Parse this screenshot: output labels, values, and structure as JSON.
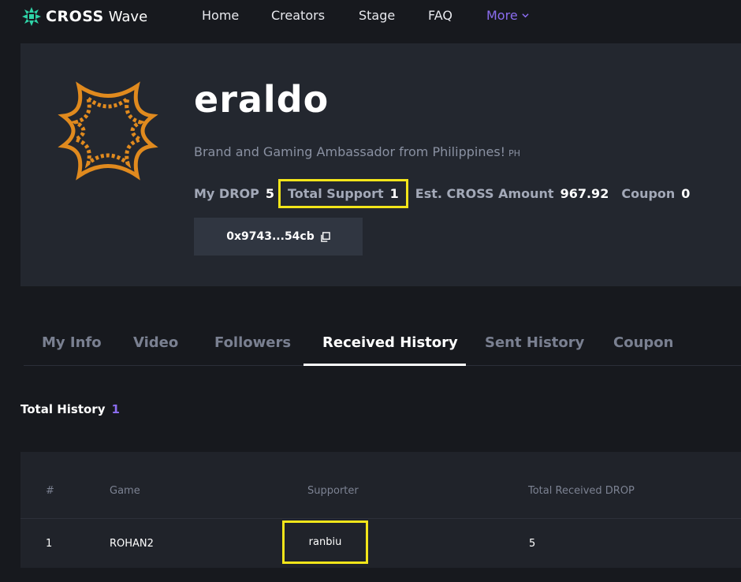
{
  "brand": {
    "name": "CROSS",
    "sub": "Wave",
    "accent": "#2fd3a7"
  },
  "nav": {
    "home": "Home",
    "creators": "Creators",
    "stage": "Stage",
    "faq": "FAQ",
    "more": "More"
  },
  "profile": {
    "name": "eraldo",
    "bio": "Brand and Gaming Ambassador from Philippines!",
    "country": "PH",
    "stats": {
      "my_drop_label": "My DROP",
      "my_drop_value": "5",
      "total_support_label": "Total Support",
      "total_support_value": "1",
      "est_cross_label": "Est. CROSS Amount",
      "est_cross_value": "967.92",
      "coupon_label": "Coupon",
      "coupon_value": "0"
    },
    "wallet": "0x9743...54cb"
  },
  "tabs": [
    "My Info",
    "Video",
    "Followers",
    "Received History",
    "Sent History",
    "Coupon"
  ],
  "history": {
    "total_label": "Total History",
    "total_count": "1",
    "columns": {
      "index": "#",
      "game": "Game",
      "supporter": "Supporter",
      "received": "Total Received DROP"
    },
    "rows": [
      {
        "index": "1",
        "game": "ROHAN2",
        "supporter": "ranbiu",
        "received": "5"
      }
    ]
  },
  "colors": {
    "accent_purple": "#8b6df0",
    "highlight": "#f2e51a",
    "avatar_orange": "#e08a1e"
  }
}
